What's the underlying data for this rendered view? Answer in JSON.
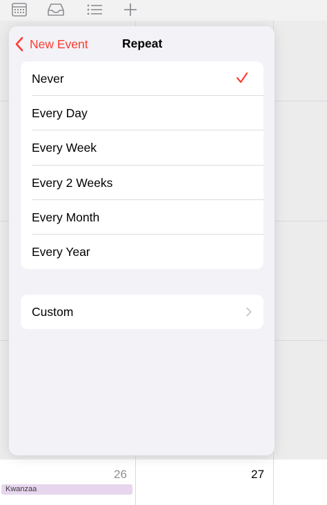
{
  "toolbar": {
    "icons": [
      "calendar-icon",
      "inbox-icon",
      "list-icon",
      "add-icon"
    ]
  },
  "nav": {
    "back_label": "New Event",
    "title": "Repeat"
  },
  "repeat_options": [
    {
      "label": "Never",
      "selected": true
    },
    {
      "label": "Every Day",
      "selected": false
    },
    {
      "label": "Every Week",
      "selected": false
    },
    {
      "label": "Every 2 Weeks",
      "selected": false
    },
    {
      "label": "Every Month",
      "selected": false
    },
    {
      "label": "Every Year",
      "selected": false
    }
  ],
  "custom": {
    "label": "Custom"
  },
  "calendar": {
    "day_26": "26",
    "day_27": "27",
    "event_title": "Kwanzaa"
  },
  "colors": {
    "accent": "#ff3b30",
    "event_chip": "#e7d6ee"
  }
}
